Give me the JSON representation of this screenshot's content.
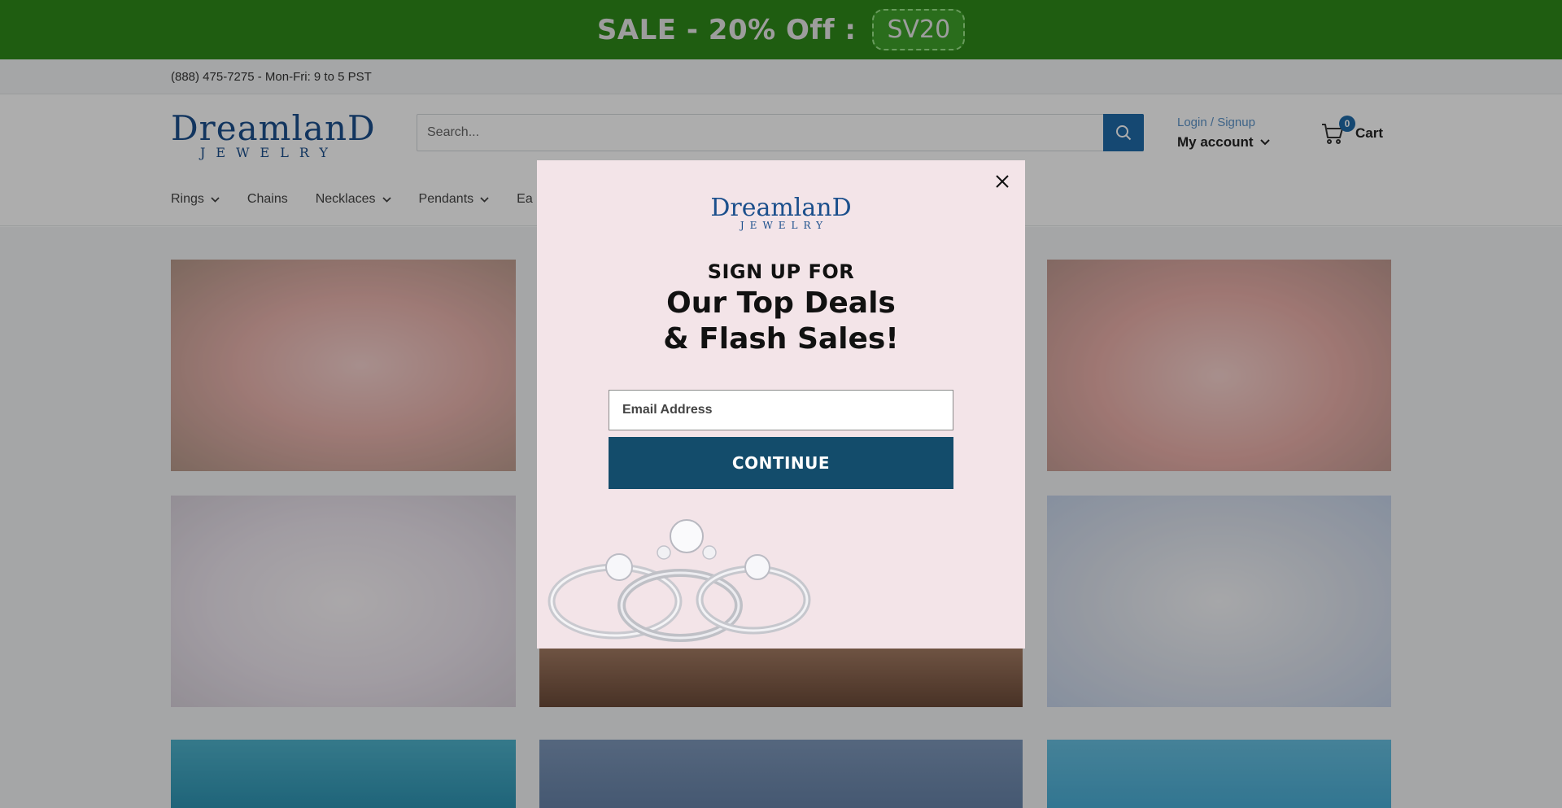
{
  "sale_banner": {
    "text": "SALE - 20% Off :",
    "code": "SV20"
  },
  "info_bar": {
    "phone_hours": "(888) 475-7275 - Mon-Fri: 9 to 5 PST"
  },
  "header": {
    "logo": {
      "top": "DreamlanD",
      "bottom": "JEWELRY"
    },
    "search": {
      "placeholder": "Search..."
    },
    "account": {
      "login_label": "Login / Signup",
      "my_account_label": "My account"
    },
    "cart": {
      "count": "0",
      "label": "Cart"
    }
  },
  "nav": {
    "items": [
      {
        "label": "Rings",
        "has_dropdown": true
      },
      {
        "label": "Chains",
        "has_dropdown": false
      },
      {
        "label": "Necklaces",
        "has_dropdown": true
      },
      {
        "label": "Pendants",
        "has_dropdown": true
      },
      {
        "label": "Ea",
        "has_dropdown": false
      }
    ]
  },
  "modal": {
    "logo": {
      "top": "DreamlanD",
      "bottom": "JEWELRY"
    },
    "heading_small": "SIGN UP FOR",
    "heading_line1": "Our Top Deals",
    "heading_line2": "& Flash Sales!",
    "email_placeholder": "Email Address",
    "continue_label": "CONTINUE"
  },
  "colors": {
    "sale_green": "#2e8a1a",
    "brand_blue": "#1b4f8c",
    "search_button": "#1f6aa8",
    "modal_bg": "#f3e4e8",
    "continue_button": "#134c6b"
  }
}
